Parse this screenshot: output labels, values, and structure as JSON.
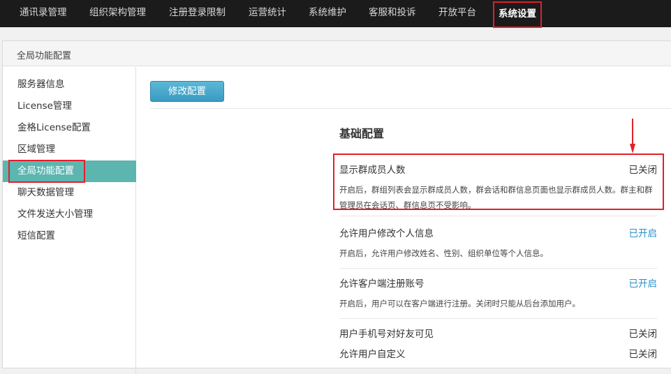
{
  "topnav": {
    "items": [
      "通讯录管理",
      "组织架构管理",
      "注册登录限制",
      "运营统计",
      "系统维护",
      "客服和投诉",
      "开放平台",
      "系统设置"
    ]
  },
  "panel": {
    "title": "全局功能配置"
  },
  "sidebar": {
    "items": [
      "服务器信息",
      "License管理",
      "金格License配置",
      "区域管理",
      "全局功能配置",
      "聊天数据管理",
      "文件发送大小管理",
      "短信配置"
    ]
  },
  "main": {
    "edit_button": "修改配置",
    "section_title": "基础配置",
    "settings": [
      {
        "name": "显示群成员人数",
        "status": "已关闭",
        "desc": "开启后，群组列表会显示群成员人数，群会话和群信息页面也显示群成员人数。群主和群管理员在会话页、群信息页不受影响。"
      },
      {
        "name": "允许用户修改个人信息",
        "status": "已开启",
        "desc": "开启后，允许用户修改姓名、性别、组织单位等个人信息。"
      },
      {
        "name": "允许客户端注册账号",
        "status": "已开启",
        "desc": "开启后，用户可以在客户端进行注册。关闭时只能从后台添加用户。"
      },
      {
        "name": "用户手机号对好友可见",
        "status": "已关闭",
        "desc": ""
      },
      {
        "name": "允许用户自定义",
        "status": "已关闭",
        "desc": ""
      }
    ]
  },
  "colors": {
    "topnav_bg": "#1b1b1b",
    "accent_teal": "#5db5b0",
    "button_blue": "#3a9cc2",
    "status_on": "#2a8fc9",
    "highlight_red": "#e0202a"
  }
}
